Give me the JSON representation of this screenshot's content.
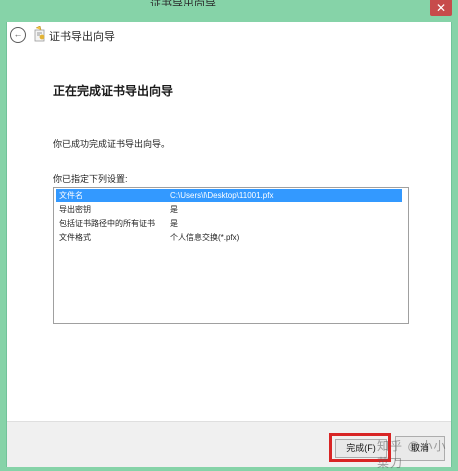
{
  "window": {
    "title": "证书导出向导",
    "close_glyph": "✕"
  },
  "nav": {
    "back_glyph": "←",
    "title": "证书导出向导"
  },
  "content": {
    "heading": "正在完成证书导出向导",
    "success_text": "你已成功完成证书导出向导。",
    "settings_label": "你已指定下列设置:",
    "settings": [
      {
        "key": "文件名",
        "value": "C:\\Users\\l\\Desktop\\11001.pfx"
      },
      {
        "key": "导出密钥",
        "value": "是"
      },
      {
        "key": "包括证书路径中的所有证书",
        "value": "是"
      },
      {
        "key": "文件格式",
        "value": "个人信息交换(*.pfx)"
      }
    ]
  },
  "footer": {
    "finish_label": "完成(F)",
    "cancel_label": "取消",
    "watermark": "知乎 @小小菜刀"
  },
  "colors": {
    "background": "#86d3a8",
    "selection": "#3399ff",
    "highlight_border": "#d82525",
    "close_button": "#c74b4b"
  },
  "icons": [
    "back-arrow-icon",
    "certificate-wizard-icon",
    "close-icon"
  ]
}
